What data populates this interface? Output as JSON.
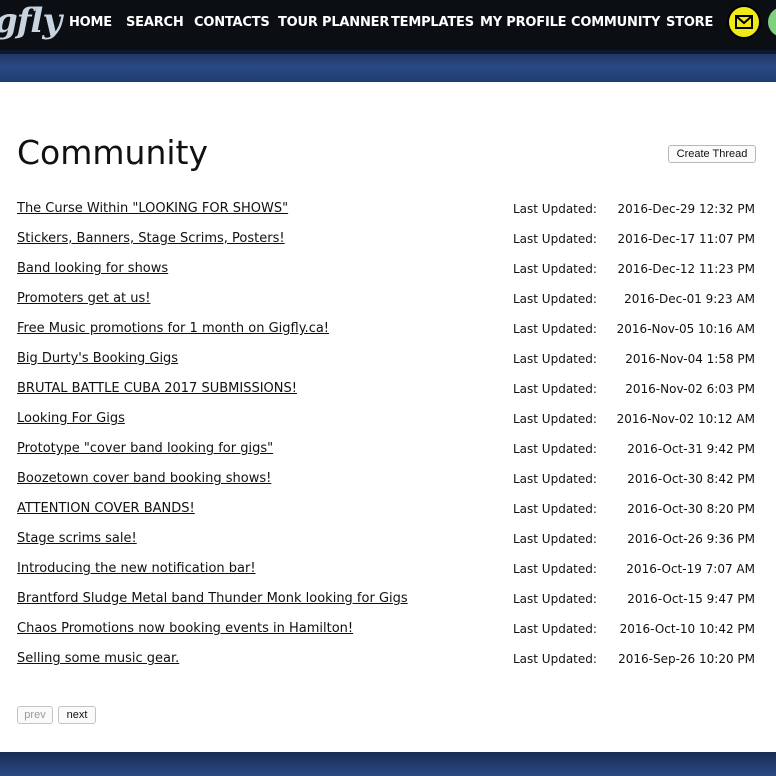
{
  "nav": {
    "logo": "gfly",
    "items": [
      "HOME",
      "SEARCH",
      "CONTACTS",
      "TOUR PLANNER",
      "TEMPLATES",
      "MY PROFILE",
      "COMMUNITY",
      "STORE"
    ],
    "icons": {
      "mail": "envelope-icon",
      "other": "green-circle-icon"
    },
    "colors": {
      "bar": "#0b0e13",
      "mail": "#f2ea17",
      "band": "#2a4a86"
    }
  },
  "page": {
    "title": "Community",
    "create_label": "Create Thread"
  },
  "threads": [
    {
      "title": "The Curse Within \"LOOKING FOR SHOWS\"",
      "label": "Last Updated:",
      "date": "2016-Dec-29 12:32 PM"
    },
    {
      "title": "Stickers, Banners, Stage Scrims, Posters!",
      "label": "Last Updated:",
      "date": "2016-Dec-17 11:07 PM"
    },
    {
      "title": "Band looking for shows",
      "label": "Last Updated:",
      "date": "2016-Dec-12 11:23 PM"
    },
    {
      "title": "Promoters get at us!",
      "label": "Last Updated:",
      "date": "2016-Dec-01 9:23 AM"
    },
    {
      "title": "Free Music promotions for 1 month on Gigfly.ca!",
      "label": "Last Updated:",
      "date": "2016-Nov-05 10:16 AM"
    },
    {
      "title": "Big Durty's Booking Gigs",
      "label": "Last Updated:",
      "date": "2016-Nov-04 1:58 PM"
    },
    {
      "title": "BRUTAL BATTLE CUBA 2017 SUBMISSIONS!",
      "label": "Last Updated:",
      "date": "2016-Nov-02 6:03 PM"
    },
    {
      "title": "Looking For Gigs",
      "label": "Last Updated:",
      "date": "2016-Nov-02 10:12 AM"
    },
    {
      "title": "Prototype \"cover band looking for gigs\"",
      "label": "Last Updated:",
      "date": "2016-Oct-31 9:42 PM"
    },
    {
      "title": "Boozetown cover band booking shows!",
      "label": "Last Updated:",
      "date": "2016-Oct-30 8:42 PM"
    },
    {
      "title": "ATTENTION COVER BANDS!",
      "label": "Last Updated:",
      "date": "2016-Oct-30 8:20 PM"
    },
    {
      "title": "Stage scrims sale!",
      "label": "Last Updated:",
      "date": "2016-Oct-26 9:36 PM"
    },
    {
      "title": "Introducing the new notification bar!",
      "label": "Last Updated:",
      "date": "2016-Oct-19 7:07 AM"
    },
    {
      "title": "Brantford Sludge Metal band Thunder Monk looking for Gigs",
      "label": "Last Updated:",
      "date": "2016-Oct-15 9:47 PM"
    },
    {
      "title": "Chaos Promotions now booking events in Hamilton!",
      "label": "Last Updated:",
      "date": "2016-Oct-10 10:42 PM"
    },
    {
      "title": "Selling some music gear.",
      "label": "Last Updated:",
      "date": "2016-Sep-26 10:20 PM"
    }
  ],
  "pager": {
    "prev": "prev",
    "next": "next"
  }
}
